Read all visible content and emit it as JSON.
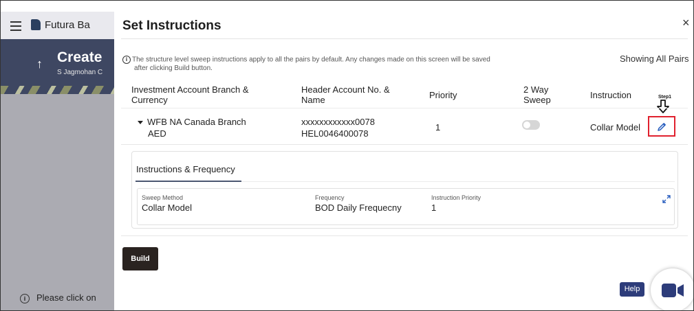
{
  "background": {
    "brand": "Futura Ba",
    "banner_title": "Create",
    "banner_subtitle": "S Jagmohan C",
    "arrow": "↑",
    "note": "Please click on"
  },
  "modal": {
    "title": "Set Instructions",
    "close": "×",
    "info_line1": "The structure level sweep instructions apply to all the pairs by default. Any changes made on this screen will be saved",
    "info_line2": "after clicking Build button.",
    "showing": "Showing All Pairs",
    "columns": {
      "account": "Investment Account Branch & Currency",
      "header_account": "Header Account No. & Name",
      "priority": "Priority",
      "two_way": "2 Way Sweep",
      "instruction": "Instruction"
    },
    "row": {
      "branch": "WFB NA Canada Branch",
      "currency": "AED",
      "account_no": "xxxxxxxxxxxx0078",
      "account_name": "HEL0046400078",
      "priority": "1",
      "two_way_sweep": false,
      "instruction": "Collar Model"
    },
    "step_label": "Step1",
    "panel": {
      "tab": "Instructions & Frequency",
      "fields": [
        {
          "label": "Sweep Method",
          "value": "Collar Model"
        },
        {
          "label": "Frequency",
          "value": "BOD Daily Frequecny"
        },
        {
          "label": "Instruction Priority",
          "value": "1"
        }
      ]
    },
    "build": "Build"
  },
  "help": "Help",
  "colors": {
    "highlight": "#e0202d",
    "build_bg": "#2a2320",
    "help_bg": "#2d3c7a",
    "edit_icon": "#2a5fbf",
    "video_icon": "#2d3c7a"
  }
}
